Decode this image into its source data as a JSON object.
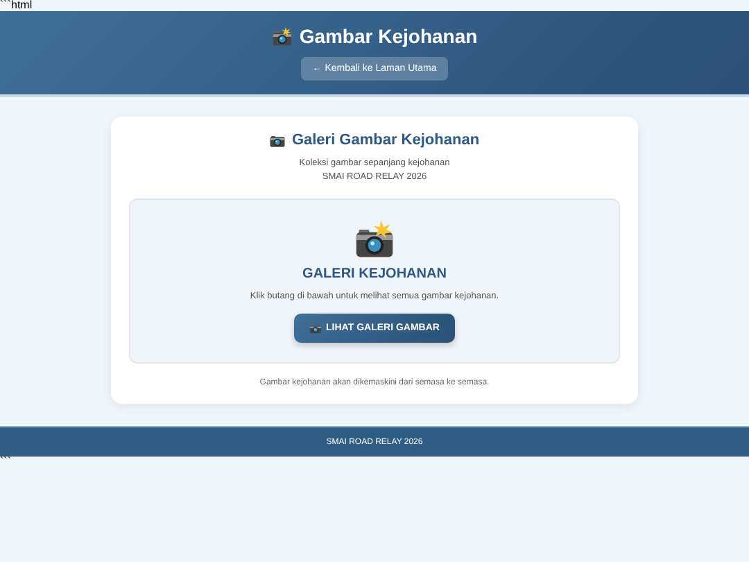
{
  "leading_text": "```html",
  "header": {
    "title": "Gambar Kejohanan",
    "back_button": "← Kembali ke Laman Utama"
  },
  "card": {
    "title": "Galeri Gambar Kejohanan",
    "subtitle": "Koleksi gambar sepanjang kejohanan",
    "event": "SMAI ROAD RELAY 2026",
    "panel": {
      "heading": "GALERI KEJOHANAN",
      "text": "Klik butang di bawah untuk melihat semua gambar kejohanan.",
      "button": "LIHAT GALERI GAMBAR"
    },
    "note": "Gambar kejohanan akan dikemaskini dari semasa ke semasa."
  },
  "footer": "SMAI ROAD RELAY 2026",
  "trailing_text": "```"
}
